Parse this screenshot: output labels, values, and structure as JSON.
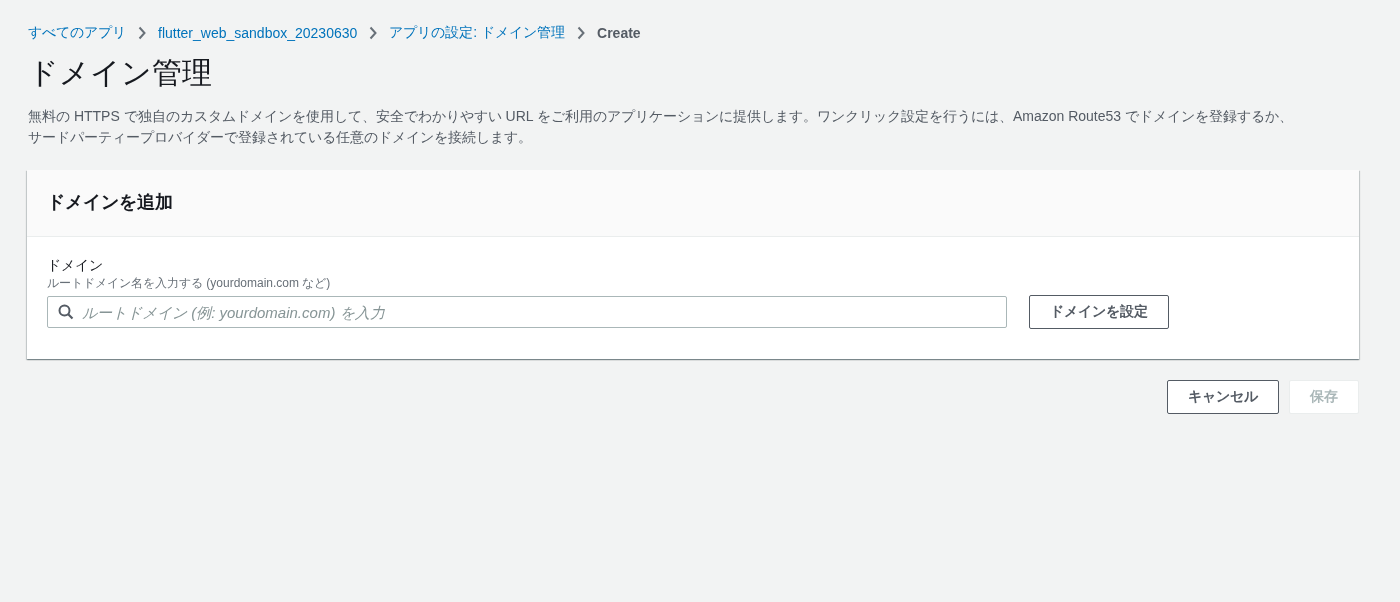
{
  "breadcrumbs": [
    {
      "label": "すべてのアプリ",
      "kind": "link"
    },
    {
      "label": "flutter_web_sandbox_20230630",
      "kind": "link"
    },
    {
      "label": "アプリの設定: ドメイン管理",
      "kind": "link"
    },
    {
      "label": "Create",
      "kind": "current"
    }
  ],
  "page": {
    "title": "ドメイン管理",
    "description": "無料の HTTPS で独自のカスタムドメインを使用して、安全でわかりやすい URL をご利用のアプリケーションに提供します。ワンクリック設定を行うには、Amazon Route53 でドメインを登録するか、サードパーティープロバイダーで登録されている任意のドメインを接続します。"
  },
  "card": {
    "title": "ドメインを追加",
    "field_label": "ドメイン",
    "field_hint": "ルートドメイン名を入力する (yourdomain.com など)",
    "placeholder": "ルートドメイン (例: yourdomain.com) を入力",
    "button": "ドメインを設定"
  },
  "actions": [
    {
      "label": "キャンセル",
      "disabled": false
    },
    {
      "label": "保存",
      "disabled": true
    }
  ]
}
